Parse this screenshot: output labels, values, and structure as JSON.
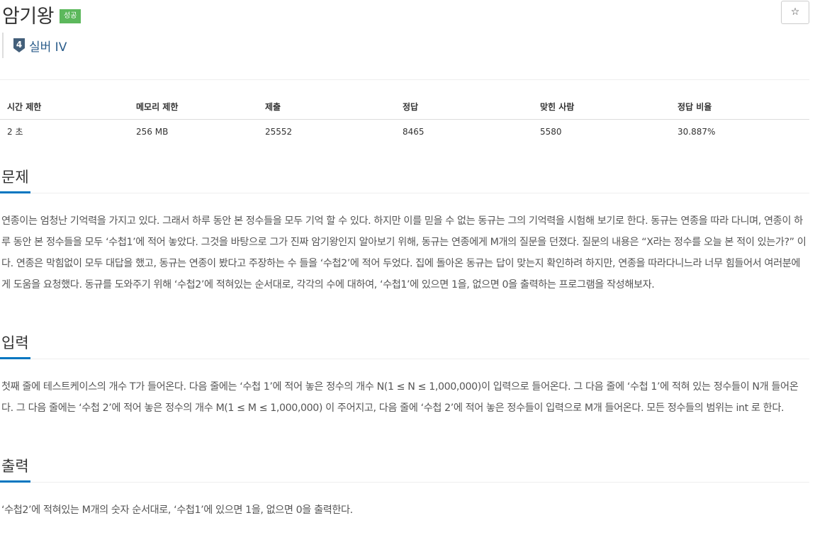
{
  "problem": {
    "title": "암기왕",
    "status_badge": "성공",
    "star_icon": "☆",
    "tier_level": "4",
    "tier_label": "실버 IV"
  },
  "info_table": {
    "headers": [
      "시간 제한",
      "메모리 제한",
      "제출",
      "정답",
      "맞힌 사람",
      "정답 비율"
    ],
    "values": [
      "2 초",
      "256 MB",
      "25552",
      "8465",
      "5580",
      "30.887%"
    ]
  },
  "sections": {
    "description": {
      "title": "문제",
      "text": "연종이는 엄청난 기억력을 가지고 있다. 그래서 하루 동안 본 정수들을 모두 기억 할 수 있다. 하지만 이를 믿을 수 없는 동규는 그의 기억력을 시험해 보기로 한다. 동규는 연종을 따라 다니며, 연종이 하루 동안 본 정수들을 모두 ‘수첩1’에 적어 놓았다. 그것을 바탕으로 그가 진짜 암기왕인지 알아보기 위해, 동규는 연종에게 M개의 질문을 던졌다. 질문의 내용은 “X라는 정수를 오늘 본 적이 있는가?” 이다. 연종은 막힘없이 모두 대답을 했고, 동규는 연종이 봤다고 주장하는 수 들을 ‘수첩2’에 적어 두었다. 집에 돌아온 동규는 답이 맞는지 확인하려 하지만, 연종을 따라다니느라 너무 힘들어서 여러분에게 도움을 요청했다. 동규를 도와주기 위해 ‘수첩2’에 적혀있는 순서대로, 각각의 수에 대하여, ‘수첩1’에 있으면 1을, 없으면 0을 출력하는 프로그램을 작성해보자."
    },
    "input": {
      "title": "입력",
      "text": "첫째 줄에 테스트케이스의 개수 T가 들어온다. 다음 줄에는 ‘수첩 1’에 적어 놓은 정수의 개수 N(1 ≤ N ≤ 1,000,000)이 입력으로 들어온다. 그 다음 줄에  ‘수첩 1’에 적혀 있는 정수들이 N개 들어온다. 그 다음 줄에는 ‘수첩 2’에 적어 놓은 정수의 개수 M(1 ≤ M ≤ 1,000,000) 이 주어지고, 다음 줄에 ‘수첩 2’에 적어 놓은 정수들이 입력으로 M개 들어온다. 모든 정수들의 범위는 int 로 한다."
    },
    "output": {
      "title": "출력",
      "text": "‘수첩2’에 적혀있는 M개의 숫자 순서대로, ‘수첩1’에 있으면 1을, 없으면 0을 출력한다."
    }
  },
  "colors": {
    "badge": "#5cb85c",
    "tier": "#2b5d8b",
    "section_underline": "#0076c0"
  }
}
